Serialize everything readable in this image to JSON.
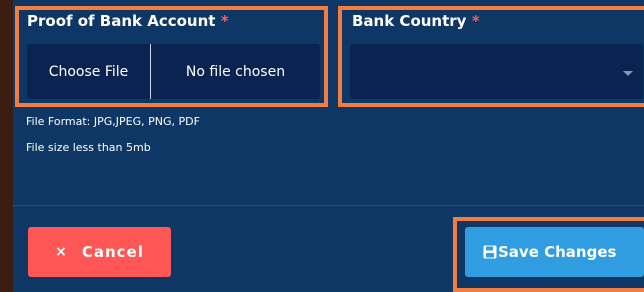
{
  "proof_field": {
    "label": "Proof of Bank Account",
    "required_mark": "*",
    "choose_button": "Choose File",
    "file_status": "No file chosen"
  },
  "country_field": {
    "label": "Bank Country",
    "required_mark": "*",
    "selected_value": ""
  },
  "hints": {
    "format": "File Format: JPG,JPEG, PNG, PDF",
    "size": "File size less than 5mb"
  },
  "actions": {
    "cancel_icon": "×",
    "cancel_label": "Cancel",
    "save_label": "Save Changes",
    "save_icon": "floppy-disk-icon"
  },
  "colors": {
    "panel_bg": "#0f3766",
    "field_bg": "#0a2350",
    "highlight": "#f27d3e",
    "required": "#ff5b5b",
    "cancel": "#ff5656",
    "save": "#2f9de0"
  }
}
